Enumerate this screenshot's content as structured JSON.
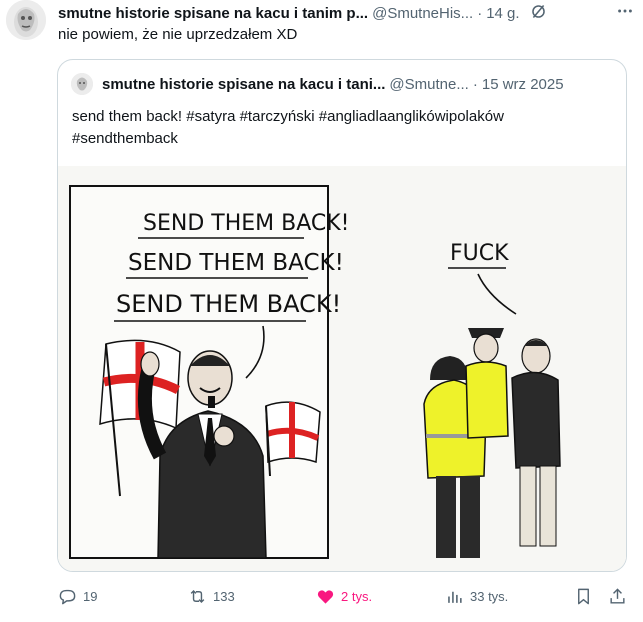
{
  "post": {
    "author_name": "smutne historie spisane na kacu i tanim p...",
    "author_handle": "@SmutneHis...",
    "separator": "·",
    "time": "14 g.",
    "text": "nie powiem, że nie uprzedzałem XD"
  },
  "quote": {
    "author_name": "smutne historie spisane na kacu i tani...",
    "author_handle": "@Smutne...",
    "separator": "·",
    "date": "15 wrz 2025",
    "text_line1": "send them back! #satyra #tarczyński #angliadlaanglikówipolaków",
    "text_line2": "#sendthemback",
    "image": {
      "speech_line1": "SEND THEM BACK!",
      "speech_line2": "SEND THEM BACK!",
      "speech_line3": "SEND THEM BACK!",
      "speech_right": "FUCK"
    }
  },
  "actions": {
    "replies": "19",
    "reposts": "133",
    "likes": "2 tys.",
    "views": "33 tys.",
    "like_color": "#f91880"
  },
  "icons": [
    "reply-icon",
    "repost-icon",
    "heart-icon",
    "views-icon",
    "bookmark-icon",
    "share-icon",
    "grok-icon",
    "more-icon"
  ]
}
